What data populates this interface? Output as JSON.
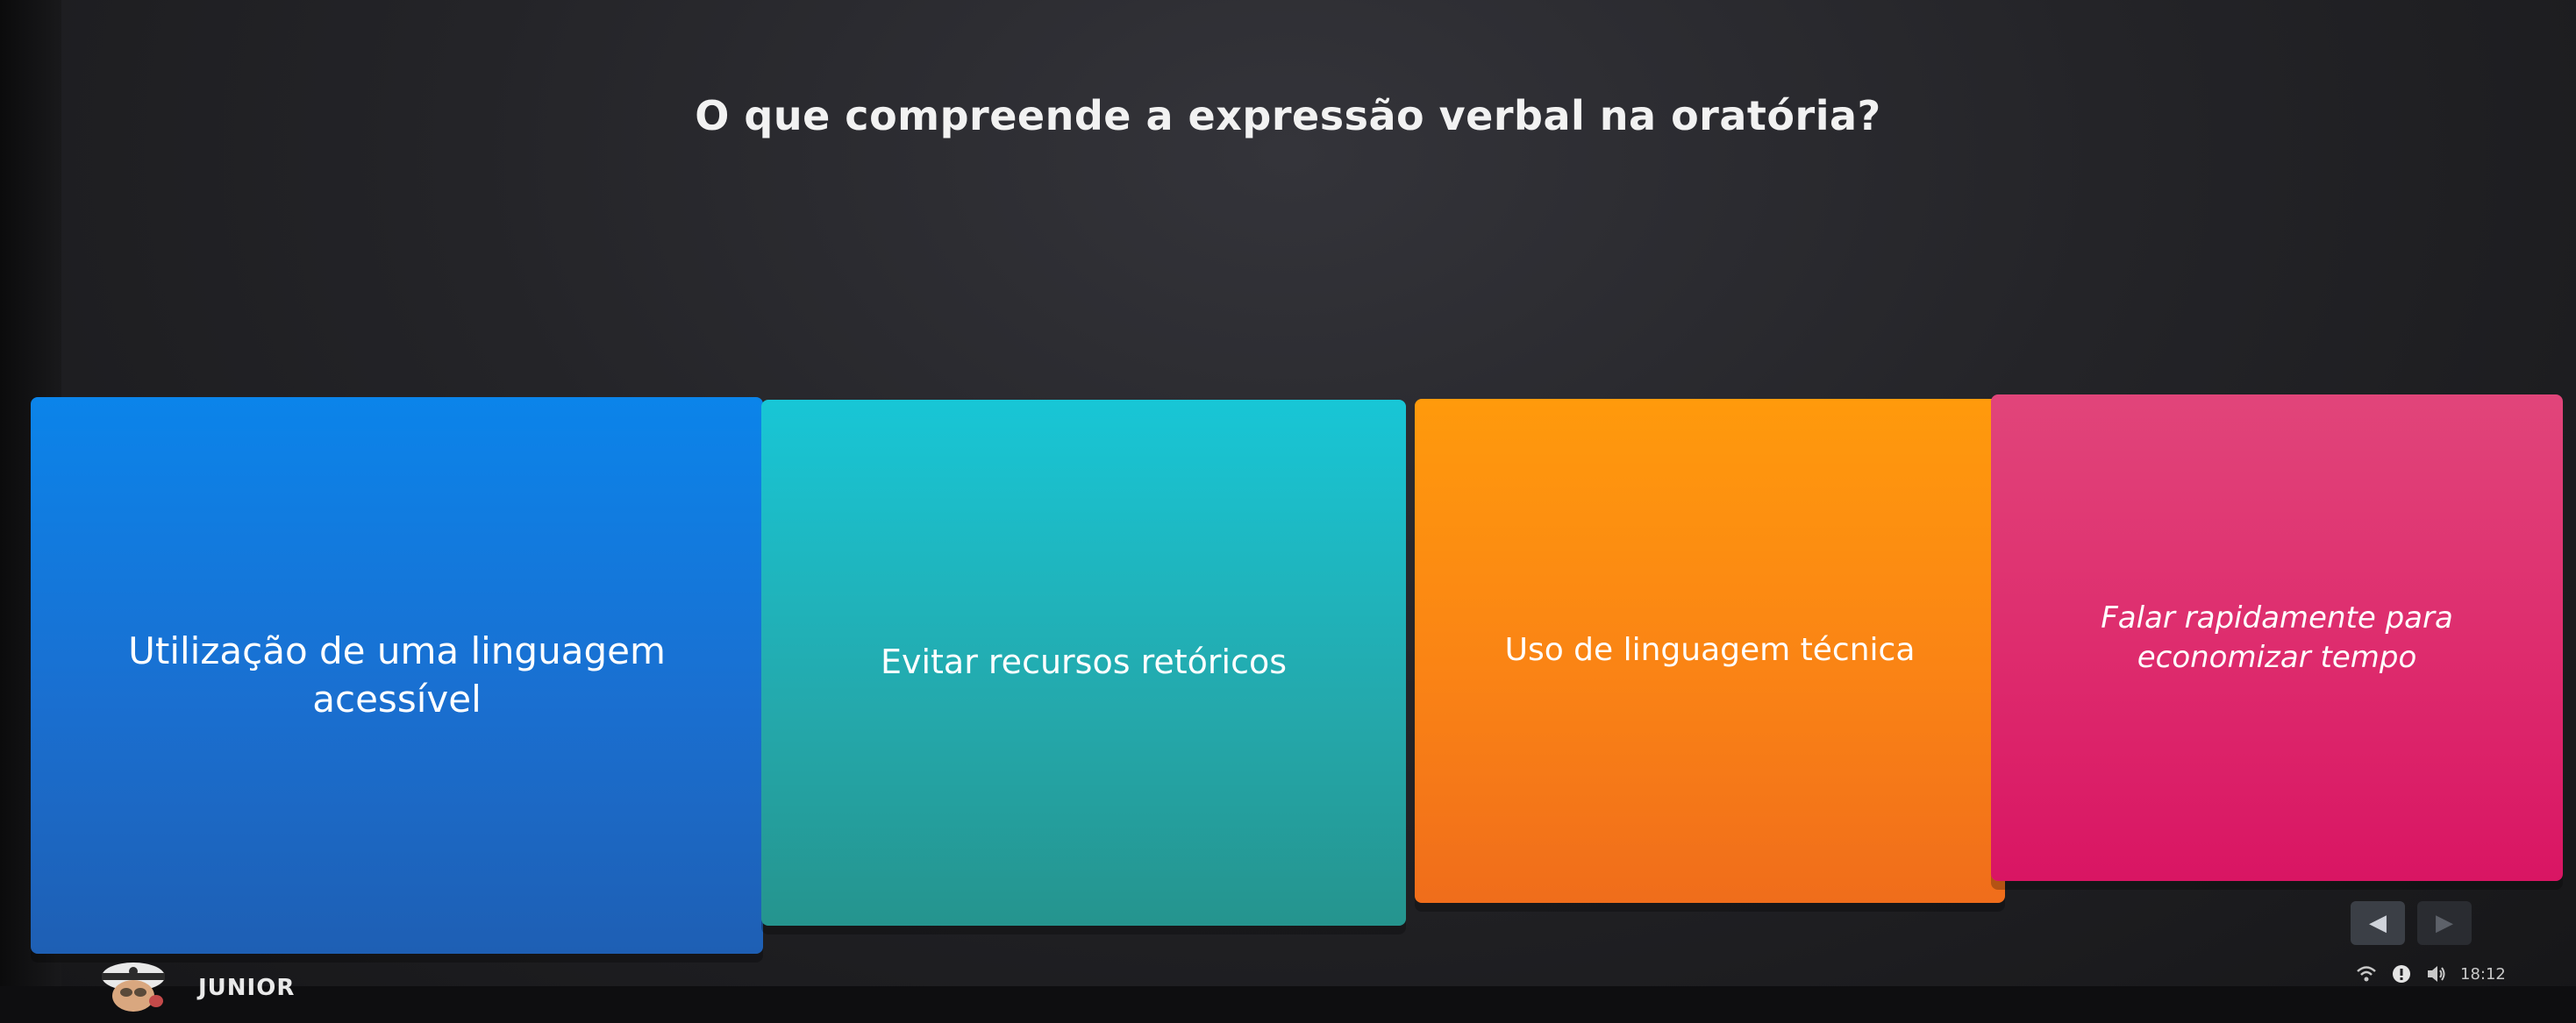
{
  "question": {
    "text": "O que compreende a expressão verbal na oratória?"
  },
  "answers": [
    {
      "label": "Utilização de uma linguagem acessível",
      "color": "#1a6fd0"
    },
    {
      "label": "Evitar recursos retóricos",
      "color": "#24a8ab"
    },
    {
      "label": "Uso de linguagem técnica",
      "color": "#fa8315"
    },
    {
      "label": "Falar rapidamente para economizar tempo",
      "color": "#de2d6e"
    }
  ],
  "navigation": {
    "prev_icon": "◀",
    "next_icon": "▶"
  },
  "player": {
    "name": "JUNIOR",
    "avatar_icon": "avatar-icon"
  },
  "system_tray": {
    "time": "18:12",
    "icons": [
      "wifi-icon",
      "notification-icon",
      "volume-icon"
    ]
  }
}
